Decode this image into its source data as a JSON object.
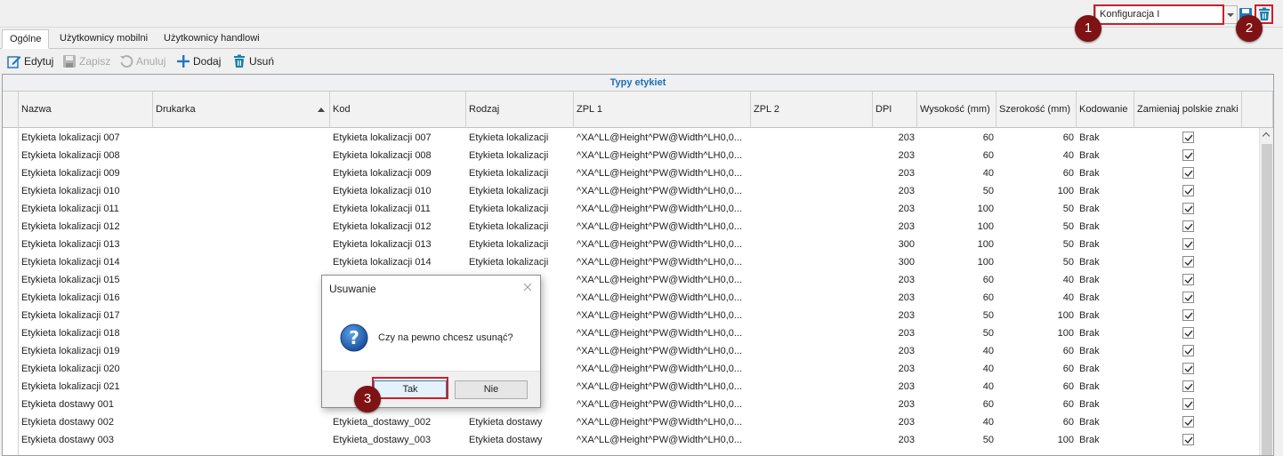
{
  "config": {
    "selected": "Konfiguracja I"
  },
  "badges": [
    "1",
    "2",
    "3"
  ],
  "tabs": [
    {
      "label": "Ogólne",
      "active": true
    },
    {
      "label": "Użytkownicy mobilni",
      "active": false
    },
    {
      "label": "Użytkownicy handlowi",
      "active": false
    }
  ],
  "toolbar": {
    "edit": "Edytuj",
    "save": "Zapisz",
    "cancel": "Anuluj",
    "add": "Dodaj",
    "delete": "Usuń"
  },
  "grid": {
    "title": "Typy etykiet",
    "columns": [
      "Nazwa",
      "Drukarka",
      "Kod",
      "Rodzaj",
      "ZPL 1",
      "ZPL 2",
      "DPI",
      "Wysokość (mm)",
      "Szerokość (mm)",
      "Kodowanie",
      "Zamieniaj polskie znaki"
    ],
    "rows": [
      [
        "Etykieta lokalizacji 007",
        "",
        "Etykieta lokalizacji 007",
        "Etykieta lokalizacji",
        "^XA^LL@Height^PW@Width^LH0,0...",
        "",
        "203",
        "60",
        "60",
        "Brak",
        "true"
      ],
      [
        "Etykieta lokalizacji 008",
        "",
        "Etykieta lokalizacji 008",
        "Etykieta lokalizacji",
        "^XA^LL@Height^PW@Width^LH0,0...",
        "",
        "203",
        "60",
        "40",
        "Brak",
        "true"
      ],
      [
        "Etykieta lokalizacji 009",
        "",
        "Etykieta lokalizacji 009",
        "Etykieta lokalizacji",
        "^XA^LL@Height^PW@Width^LH0,0...",
        "",
        "203",
        "40",
        "60",
        "Brak",
        "true"
      ],
      [
        "Etykieta lokalizacji 010",
        "",
        "Etykieta lokalizacji 010",
        "Etykieta lokalizacji",
        "^XA^LL@Height^PW@Width^LH0,0...",
        "",
        "203",
        "50",
        "100",
        "Brak",
        "true"
      ],
      [
        "Etykieta lokalizacji 011",
        "",
        "Etykieta lokalizacji 011",
        "Etykieta lokalizacji",
        "^XA^LL@Height^PW@Width^LH0,0...",
        "",
        "203",
        "100",
        "50",
        "Brak",
        "true"
      ],
      [
        "Etykieta lokalizacji 012",
        "",
        "Etykieta lokalizacji 012",
        "Etykieta lokalizacji",
        "^XA^LL@Height^PW@Width^LH0,0...",
        "",
        "203",
        "100",
        "50",
        "Brak",
        "true"
      ],
      [
        "Etykieta lokalizacji 013",
        "",
        "Etykieta lokalizacji 013",
        "Etykieta lokalizacji",
        "^XA^LL@Height^PW@Width^LH0,0...",
        "",
        "300",
        "100",
        "50",
        "Brak",
        "true"
      ],
      [
        "Etykieta lokalizacji 014",
        "",
        "Etykieta lokalizacji 014",
        "Etykieta lokalizacji",
        "^XA^LL@Height^PW@Width^LH0,0...",
        "",
        "300",
        "100",
        "50",
        "Brak",
        "true"
      ],
      [
        "Etykieta lokalizacji 015",
        "",
        "",
        "",
        "^XA^LL@Height^PW@Width^LH0,0...",
        "",
        "203",
        "60",
        "40",
        "Brak",
        "true"
      ],
      [
        "Etykieta lokalizacji 016",
        "",
        "",
        "",
        "^XA^LL@Height^PW@Width^LH0,0...",
        "",
        "203",
        "60",
        "40",
        "Brak",
        "true"
      ],
      [
        "Etykieta lokalizacji 017",
        "",
        "",
        "",
        "^XA^LL@Height^PW@Width^LH0,0...",
        "",
        "203",
        "50",
        "100",
        "Brak",
        "true"
      ],
      [
        "Etykieta lokalizacji 018",
        "",
        "",
        "",
        "^XA^LL@Height^PW@Width^LH0,0...",
        "",
        "203",
        "50",
        "100",
        "Brak",
        "true"
      ],
      [
        "Etykieta lokalizacji 019",
        "",
        "",
        "",
        "^XA^LL@Height^PW@Width^LH0,0...",
        "",
        "203",
        "40",
        "60",
        "Brak",
        "true"
      ],
      [
        "Etykieta lokalizacji 020",
        "",
        "",
        "",
        "^XA^LL@Height^PW@Width^LH0,0...",
        "",
        "203",
        "40",
        "60",
        "Brak",
        "true"
      ],
      [
        "Etykieta lokalizacji 021",
        "",
        "",
        "",
        "^XA^LL@Height^PW@Width^LH0,0...",
        "",
        "203",
        "40",
        "60",
        "Brak",
        "true"
      ],
      [
        "Etykieta dostawy 001",
        "",
        "",
        "",
        "^XA^LL@Height^PW@Width^LH0,0...",
        "",
        "203",
        "60",
        "60",
        "Brak",
        "true"
      ],
      [
        "Etykieta dostawy 002",
        "",
        "Etykieta_dostawy_002",
        "Etykieta dostawy",
        "^XA^LL@Height^PW@Width^LH0,0...",
        "",
        "203",
        "40",
        "60",
        "Brak",
        "true"
      ],
      [
        "Etykieta dostawy 003",
        "",
        "Etykieta_dostawy_003",
        "Etykieta dostawy",
        "^XA^LL@Height^PW@Width^LH0,0...",
        "",
        "203",
        "50",
        "100",
        "Brak",
        "true"
      ]
    ]
  },
  "dialog": {
    "title": "Usuwanie",
    "message": "Czy na pewno chcesz usunąć?",
    "yes": "Tak",
    "no": "Nie"
  }
}
